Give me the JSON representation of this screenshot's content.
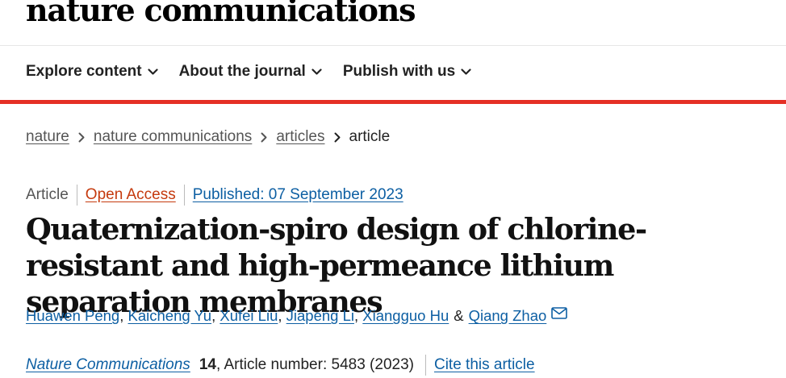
{
  "brand": {
    "name": "nature communications"
  },
  "nav": {
    "items": [
      {
        "label": "Explore content",
        "icon": "chevron-down-icon"
      },
      {
        "label": "About the journal",
        "icon": "chevron-down-icon"
      },
      {
        "label": "Publish with us",
        "icon": "chevron-down-icon"
      }
    ]
  },
  "breadcrumb": {
    "items": [
      "nature",
      "nature communications",
      "articles"
    ],
    "current": "article",
    "separator_icon": "chevron-right-icon"
  },
  "meta": {
    "type": "Article",
    "access": "Open Access",
    "published": "Published: 07 September 2023"
  },
  "article": {
    "title": "Quaternization-spiro design of chlorine-resistant and high-permeance lithium separation membranes"
  },
  "authors": {
    "list": [
      "Huawen Peng",
      "Kaicheng Yu",
      "Xufei Liu",
      "Jiapeng Li",
      "Xiangguo Hu",
      "Qiang Zhao"
    ],
    "separator": ",",
    "conjunction": "&",
    "contact_icon": "mail-icon"
  },
  "citation": {
    "journal": "Nature Communications",
    "volume": "14",
    "details": ", Article number: 5483 (2023)",
    "cite_label": "Cite this article"
  },
  "colors": {
    "accent_red": "#e52f25",
    "link_blue": "#0d5fa3",
    "open_access_orange": "#c53a0e",
    "text": "#222222",
    "muted": "#555555"
  }
}
